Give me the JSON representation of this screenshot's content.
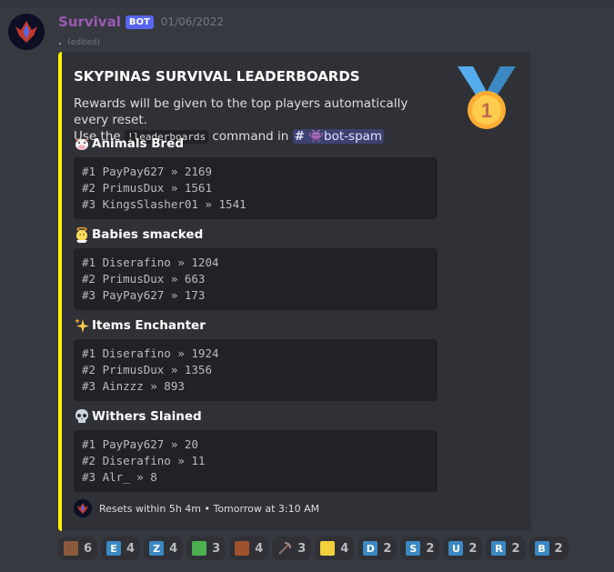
{
  "message": {
    "username": "Survival",
    "bot_tag": "BOT",
    "timestamp": "01/06/2022",
    "content": ".",
    "edited": "(edited)"
  },
  "embed": {
    "accent_color": "#fff200",
    "title": "SKYPINAS SURVIVAL LEADERBOARDS",
    "desc_line1": "Rewards will be given to the top players automatically every reset.",
    "desc_use": "Use the ",
    "desc_command": "!leaderboards",
    "desc_in": " command in ",
    "channel": "bot-spam",
    "fields": [
      {
        "name": "Animals Bred",
        "emoji": "cow-icon",
        "lines": [
          "#1 PayPay627 » 2169",
          "#2 PrimusDux » 1561",
          "#3 KingsSlasher01 » 1541"
        ]
      },
      {
        "name": "Babies smacked",
        "emoji": "angel-baby-icon",
        "lines": [
          "#1 Diserafino » 1204",
          "#2 PrimusDux » 663",
          "#3 PayPay627 » 173"
        ]
      },
      {
        "name": "Items Enchanter",
        "emoji": "sparkles-icon",
        "lines": [
          "#1 Diserafino » 1924",
          "#2 PrimusDux » 1356",
          "#3 Ainzzz » 893"
        ]
      },
      {
        "name": "Withers Slained",
        "emoji": "skull-icon",
        "lines": [
          "#1 PayPay627 » 20",
          "#2 Diserafino » 11",
          "#3 Alr_ » 8"
        ]
      }
    ],
    "footer_text": "Resets within 5h 4m • Tomorrow at 3:10 AM"
  },
  "reactions": [
    {
      "emoji": "minecraft-head-icon",
      "label": "",
      "count": "6",
      "color": "#8b5a3c"
    },
    {
      "emoji": "letter-e-icon",
      "label": "E",
      "count": "4",
      "color": "#3b88c3"
    },
    {
      "emoji": "letter-z-icon",
      "label": "Z",
      "count": "4",
      "color": "#3b88c3"
    },
    {
      "emoji": "pepe-icon",
      "label": "",
      "count": "3",
      "color": "#4caf50"
    },
    {
      "emoji": "villager-icon",
      "label": "",
      "count": "4",
      "color": "#a0522d"
    },
    {
      "emoji": "pickaxe-icon",
      "label": "",
      "count": "3",
      "color": "#8d6e63"
    },
    {
      "emoji": "spongebob-icon",
      "label": "",
      "count": "4",
      "color": "#f2d13d"
    },
    {
      "emoji": "letter-d-icon",
      "label": "D",
      "count": "2",
      "color": "#3b88c3"
    },
    {
      "emoji": "letter-s-icon",
      "label": "S",
      "count": "2",
      "color": "#3b88c3"
    },
    {
      "emoji": "letter-u-icon",
      "label": "U",
      "count": "2",
      "color": "#3b88c3"
    },
    {
      "emoji": "letter-r-icon",
      "label": "R",
      "count": "2",
      "color": "#3b88c3"
    },
    {
      "emoji": "letter-b-icon",
      "label": "B",
      "count": "2",
      "color": "#3b88c3"
    }
  ]
}
